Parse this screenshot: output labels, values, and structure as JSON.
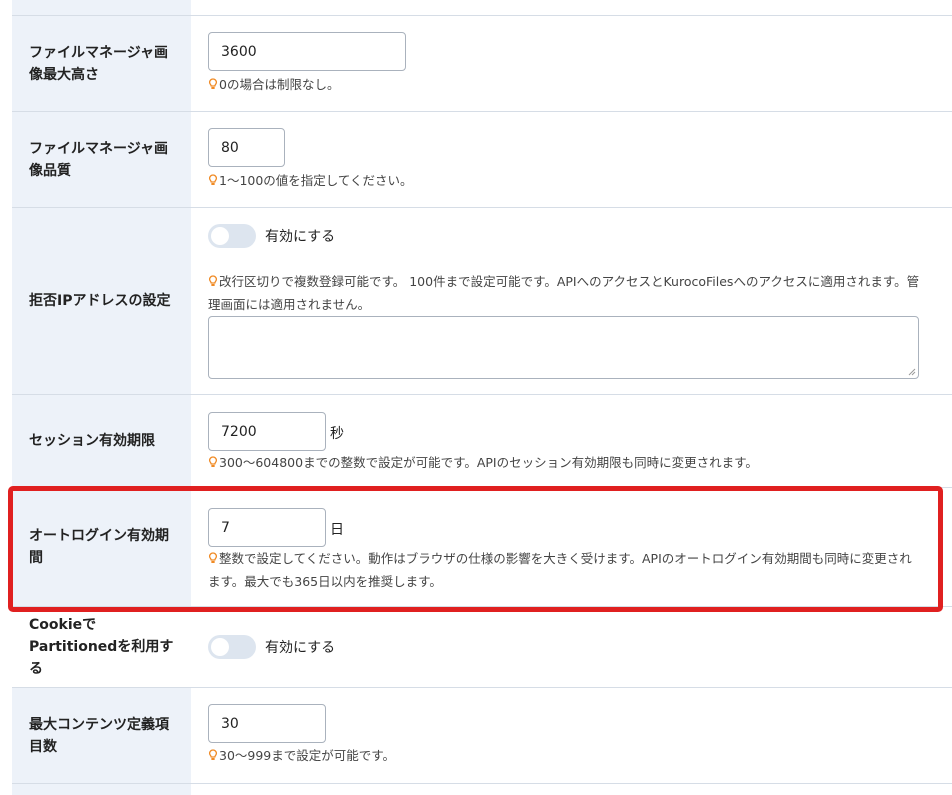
{
  "colors": {
    "label_bg": "#edf2f9",
    "border": "#d6dde6",
    "hint_icon": "#f08a24",
    "highlight": "#e02020",
    "toggle_off": "#dde5ef"
  },
  "rows": {
    "fm_max_height": {
      "label": "ファイルマネージャ画像最大高さ",
      "value": "3600",
      "hint": "0の場合は制限なし。"
    },
    "fm_quality": {
      "label": "ファイルマネージャ画像品質",
      "value": "80",
      "hint": "1〜100の値を指定してください。"
    },
    "deny_ip": {
      "label": "拒否IPアドレスの設定",
      "toggle_label": "有効にする",
      "toggle_on": false,
      "hint": "改行区切りで複数登録可能です。 100件まで設定可能です。APIへのアクセスとKurocoFilesへのアクセスに適用されます。管理画面には適用されません。",
      "textarea_value": ""
    },
    "session": {
      "label": "セッション有効期限",
      "value": "7200",
      "unit": "秒",
      "hint": "300〜604800までの整数で設定が可能です。APIのセッション有効期限も同時に変更されます。"
    },
    "autologin": {
      "label": "オートログイン有効期間",
      "value": "7",
      "unit": "日",
      "hint": "整数で設定してください。動作はブラウザの仕様の影響を大きく受けます。APIのオートログイン有効期間も同時に変更されます。最大でも365日以内を推奨します。"
    },
    "cookie_partitioned": {
      "label": "CookieでPartitionedを利用する",
      "toggle_label": "有効にする",
      "toggle_on": false
    },
    "max_content_items": {
      "label": "最大コンテンツ定義項目数",
      "value": "30",
      "hint": "30〜999まで設定が可能です。"
    }
  }
}
